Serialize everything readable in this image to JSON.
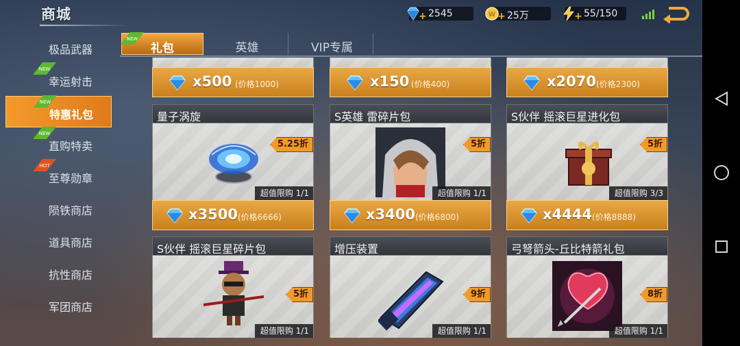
{
  "topbar": {
    "title": "商城",
    "diamonds": "2545",
    "gold": "25万",
    "energy": "55/150",
    "icons": {
      "diamond": "diamond-icon",
      "gold": "gold-coin-icon",
      "energy": "lightning-icon",
      "signal": "signal-icon",
      "back": "back-arrow-icon"
    }
  },
  "sidebar": {
    "items": [
      {
        "label": "极品武器",
        "tag": ""
      },
      {
        "label": "幸运射击",
        "tag": "NEW"
      },
      {
        "label": "特惠礼包",
        "tag": "NEW",
        "active": true
      },
      {
        "label": "直购特卖",
        "tag": "NEW"
      },
      {
        "label": "至尊勋章",
        "tag": "HOT"
      },
      {
        "label": "陨铁商店",
        "tag": ""
      },
      {
        "label": "道具商店",
        "tag": ""
      },
      {
        "label": "抗性商店",
        "tag": ""
      },
      {
        "label": "军团商店",
        "tag": ""
      }
    ]
  },
  "tabs": [
    {
      "label": "礼包",
      "tag": "NEW",
      "active": true
    },
    {
      "label": "英雄"
    },
    {
      "label": "VIP专属"
    }
  ],
  "partial_row": [
    {
      "qty": "x500",
      "orig": "(价格1000)"
    },
    {
      "qty": "x150",
      "orig": "(价格400)"
    },
    {
      "qty": "x2070",
      "orig": "(价格2300)"
    }
  ],
  "cards": [
    {
      "name": "量子涡旋",
      "discount": "5.25折",
      "limit": "超值限购 1/1",
      "qty": "x3500",
      "orig": "(价格6666)"
    },
    {
      "name": "S英雄 雷碎片包",
      "discount": "5折",
      "limit": "超值限购 1/1",
      "qty": "x3400",
      "orig": "(价格6800)"
    },
    {
      "name": "S伙伴 摇滚巨星进化包",
      "discount": "5折",
      "limit": "超值限购 3/3",
      "qty": "x4444",
      "orig": "(价格8888)"
    },
    {
      "name": "S伙伴 摇滚巨星碎片包",
      "discount": "5折",
      "limit": "超值限购 1/1"
    },
    {
      "name": "增压装置",
      "discount": "9折",
      "limit": "超值限购 1/1"
    },
    {
      "name": "弓弩箭头-丘比特箭礼包",
      "discount": "8折",
      "limit": "超值限购 1/1"
    }
  ],
  "colors": {
    "accent": "#f19a2a",
    "price_bar": "#d8902c",
    "card_body": "#d2d2cf"
  }
}
